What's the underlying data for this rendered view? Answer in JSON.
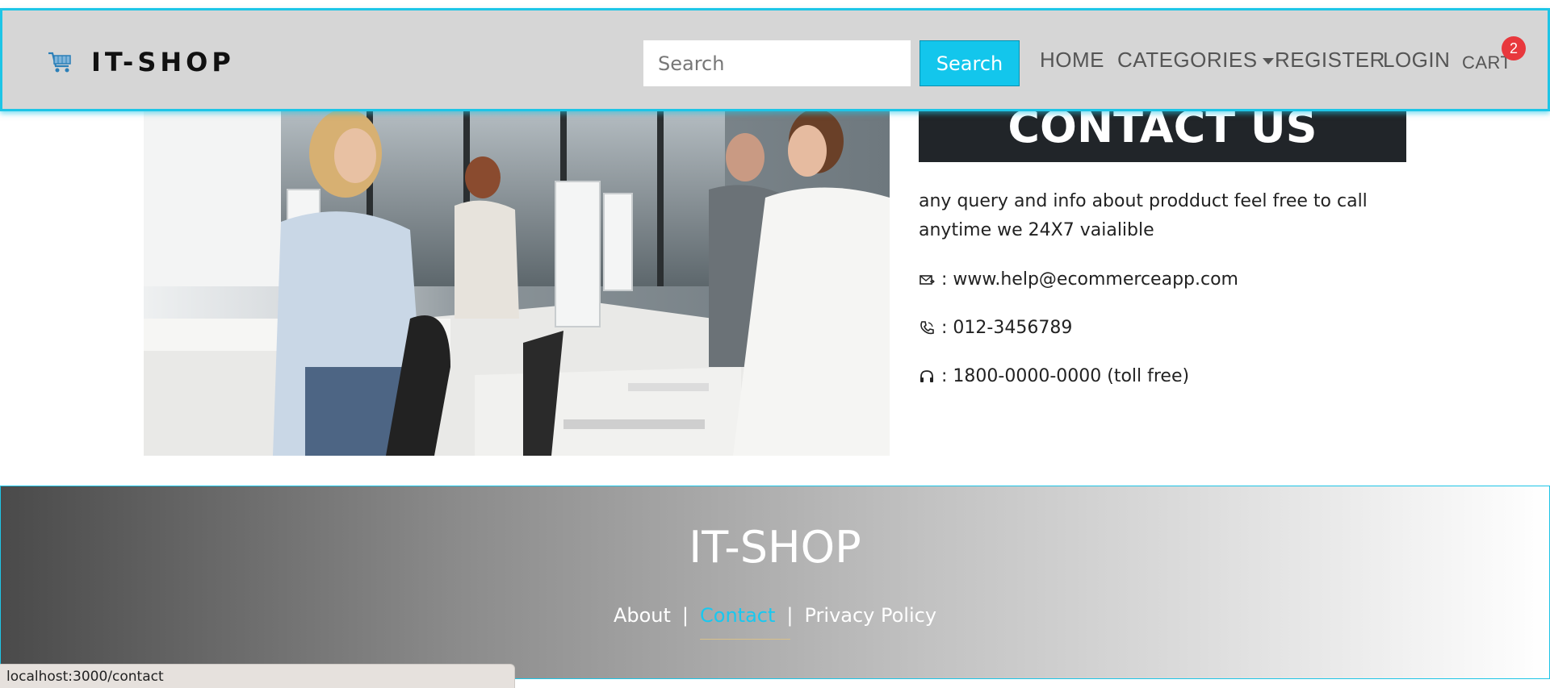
{
  "navbar": {
    "brand": "IT-SHOP",
    "brand_icon": "cart-icon",
    "search_placeholder": "Search",
    "search_button": "Search",
    "links": {
      "home": "HOME",
      "categories": "CATEGORIES",
      "register": "REGISTER",
      "login": "LOGIN",
      "cart": "CART"
    },
    "cart_count": "2",
    "accent_color": "#1ec5e6",
    "badge_color": "#e8383d"
  },
  "contact": {
    "heading": "CONTACT US",
    "description": "any query and info about prodduct feel free to call anytime we 24X7 vaialible",
    "email_label": ": www.help@ecommerceapp.com",
    "phone_label": ": 012-3456789",
    "support_label": ": 1800-0000-0000 (toll free)",
    "email_icon": "mail-icon",
    "phone_icon": "phone-icon",
    "support_icon": "headset-icon",
    "image": "call-center-photo"
  },
  "footer": {
    "title": "IT-SHOP",
    "links": {
      "about": "About",
      "contact": "Contact",
      "privacy": "Privacy Policy"
    },
    "separator": "|",
    "active_link_color": "#18c8f0"
  },
  "statusbar": {
    "url": "localhost:3000/contact"
  }
}
